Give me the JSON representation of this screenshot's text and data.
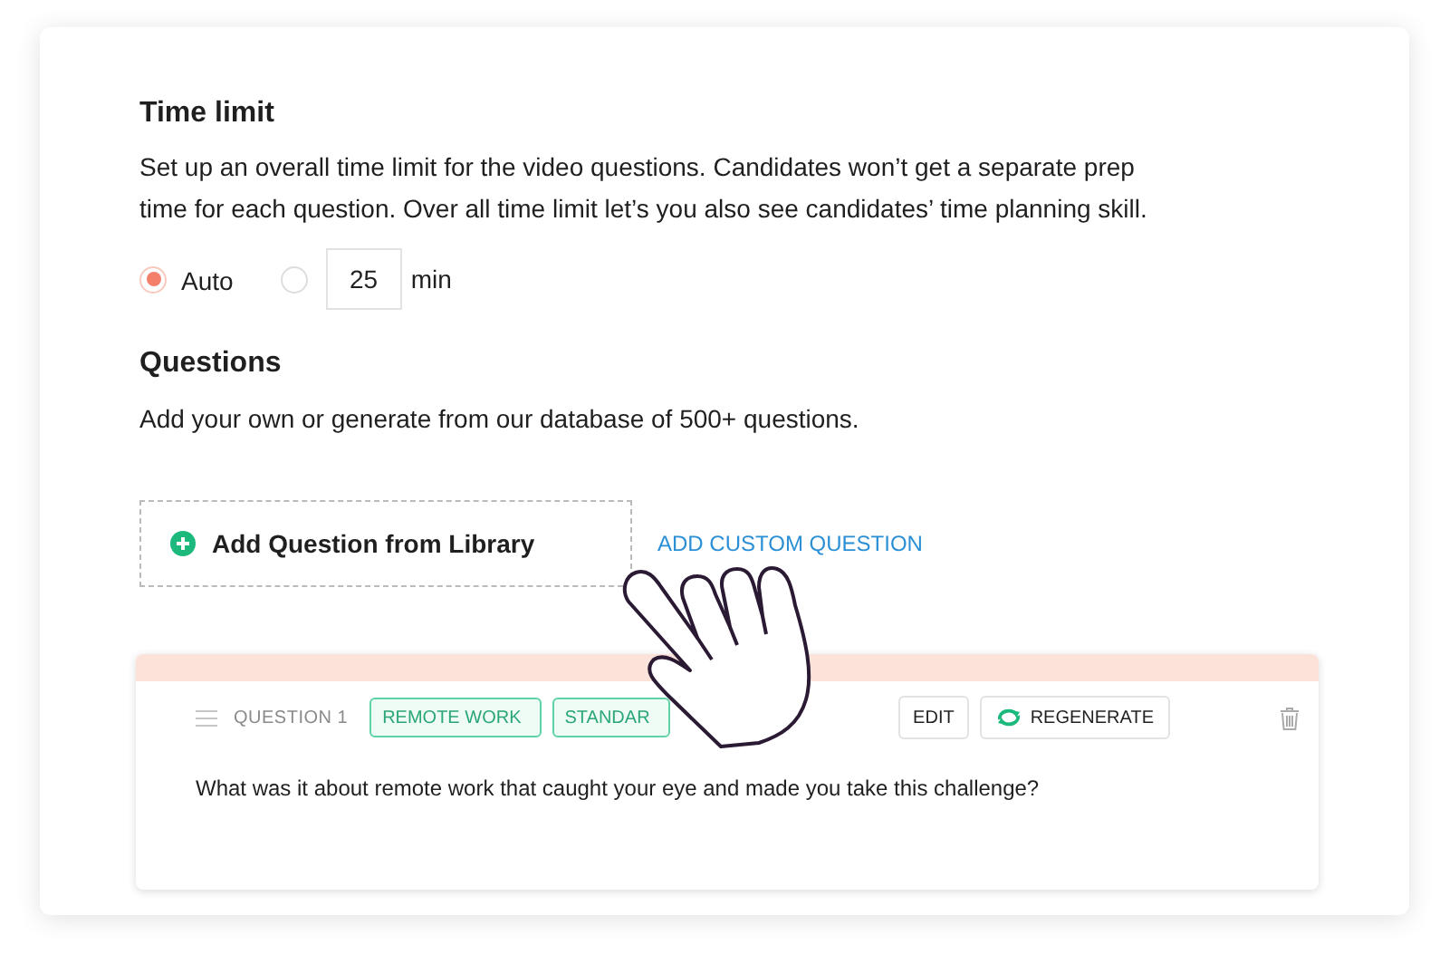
{
  "time_limit": {
    "title": "Time limit",
    "description": "Set up an overall time limit for the video questions. Candidates won’t get a separate prep time for each question. Over all time limit let’s you also see candidates’ time planning skill.",
    "options": [
      {
        "kind": "auto",
        "label": "Auto",
        "selected": true
      },
      {
        "kind": "minutes",
        "value": "25",
        "unit": "min",
        "selected": false
      }
    ]
  },
  "questions": {
    "title": "Questions",
    "description": "Add your own or generate from our database of 500+ questions.",
    "add_library_button": "Add Question from Library",
    "add_custom_link": "ADD CUSTOM QUESTION",
    "items": [
      {
        "label": "QUESTION 1",
        "tags": [
          "REMOTE WORK",
          "STANDAR"
        ],
        "edit_button": "EDIT",
        "regenerate_button": "REGENERATE",
        "text": "What was it about remote work that caught your eye and made you take this challenge?"
      }
    ]
  }
}
